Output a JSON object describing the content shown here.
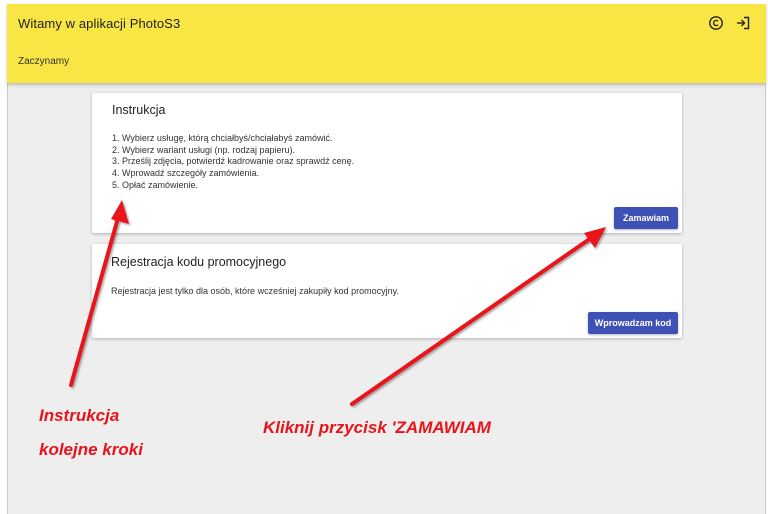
{
  "header": {
    "title": "Witamy w aplikacji PhotoS3",
    "subtitle": "Zaczynamy",
    "copyright_icon": "copyright-icon",
    "logout_icon": "logout-icon"
  },
  "instruction_card": {
    "title": "Instrukcja",
    "steps": [
      "1. Wybierz usługę, którą chciałbyś/chciałabyś zamówić.",
      "2. Wybierz wariant usługi (np. rodzaj papieru).",
      "3. Prześlij zdjęcia, potwierdź kadrowanie oraz sprawdź cenę.",
      "4. Wprowadź szczegóły zamówienia.",
      "5. Opłać zamówienie."
    ],
    "button_label": "Zamawiam"
  },
  "promo_card": {
    "title": "Rejestracja kodu promocyjnego",
    "text": "Rejestracja jest tylko dla osób, które wcześniej zakupiły kod promocyjny.",
    "button_label": "Wprowadzam kod"
  },
  "annotations": {
    "left_line1": "Instrukcja",
    "left_line2": "kolejne kroki",
    "right": "Kliknij przycisk  'ZAMAWIAM"
  },
  "colors": {
    "header_bg": "#f9e645",
    "button_bg": "#3f51b5",
    "content_bg": "#eeeeee",
    "annotation": "#e8141b"
  }
}
